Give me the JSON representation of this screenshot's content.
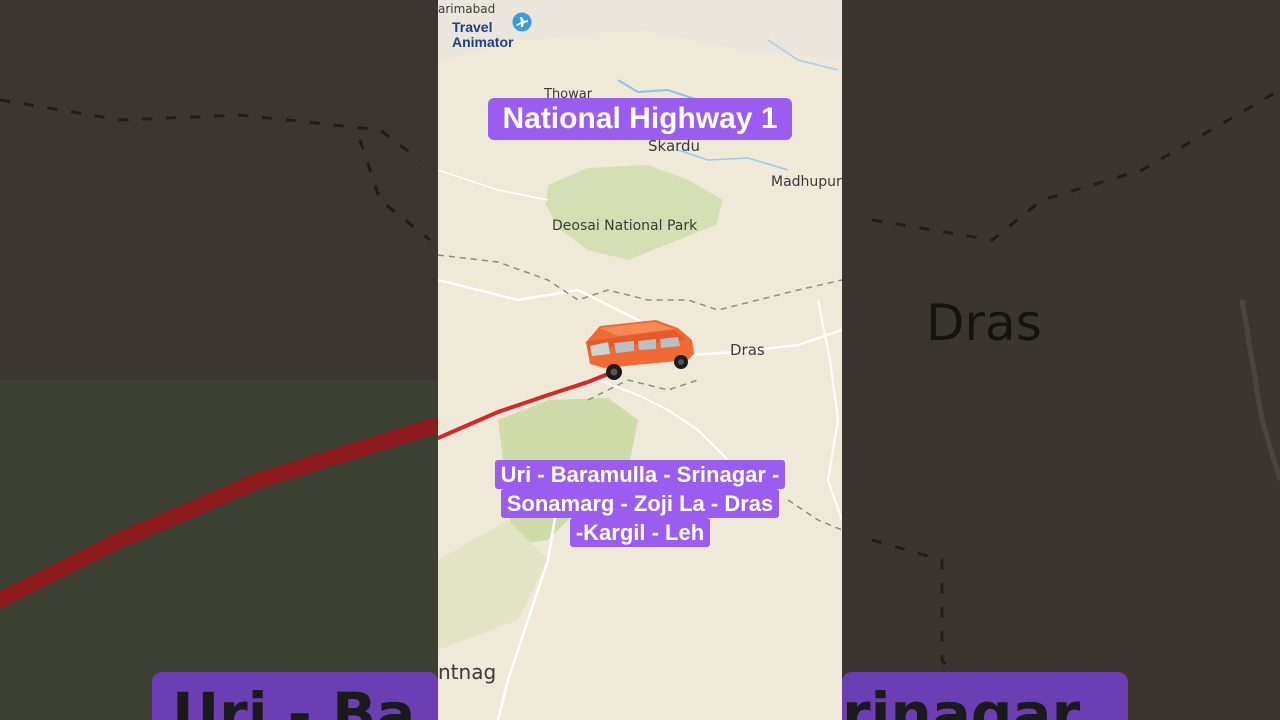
{
  "video": {
    "title": "National Highway 1",
    "route_lines": [
      "Uri - Baramulla - Srinagar -",
      "Sonamarg - Zoji La - Dras",
      "-Kargil - Leh"
    ]
  },
  "brand": {
    "line1": "Travel",
    "line2": "Animator",
    "color": "#1e3f80",
    "accent": "#3a9be0"
  },
  "map": {
    "labels": {
      "farimabad": "arimabad",
      "thowar": "Thowar",
      "skardu": "Skardu",
      "madhupur": "Madhupur",
      "deosai": "Deosai National Park",
      "dras": "Dras",
      "anantnag": "ntnag"
    },
    "route_color": "#d8262b",
    "vehicle": "orange-car",
    "vehicle_color": "#f06a35",
    "park_color": "#cfe1b3",
    "land_color": "#efe9d8"
  },
  "background": {
    "dras_label": "Dras",
    "caption_left": "Uri - Ba",
    "caption_right": "rinagar"
  },
  "colors": {
    "caption_bg": "#9b5cf0",
    "caption_text": "#ffffff"
  }
}
